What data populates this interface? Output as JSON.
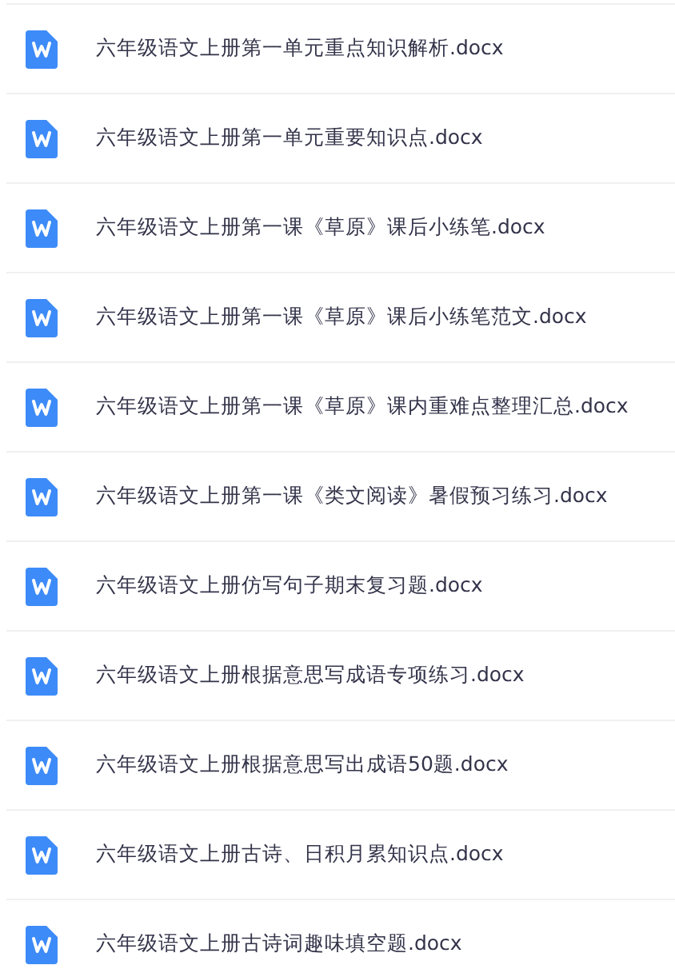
{
  "files": [
    {
      "name": "六年级语文上册第一单元重点知识解析.docx"
    },
    {
      "name": "六年级语文上册第一单元重要知识点.docx"
    },
    {
      "name": "六年级语文上册第一课《草原》课后小练笔.docx"
    },
    {
      "name": "六年级语文上册第一课《草原》课后小练笔范文.docx"
    },
    {
      "name": "六年级语文上册第一课《草原》课内重难点整理汇总.docx"
    },
    {
      "name": "六年级语文上册第一课《类文阅读》暑假预习练习.docx"
    },
    {
      "name": "六年级语文上册仿写句子期末复习题.docx"
    },
    {
      "name": "六年级语文上册根据意思写成语专项练习.docx"
    },
    {
      "name": "六年级语文上册根据意思写出成语50题.docx"
    },
    {
      "name": "六年级语文上册古诗、日积月累知识点.docx"
    },
    {
      "name": "六年级语文上册古诗词趣味填空题.docx"
    }
  ]
}
